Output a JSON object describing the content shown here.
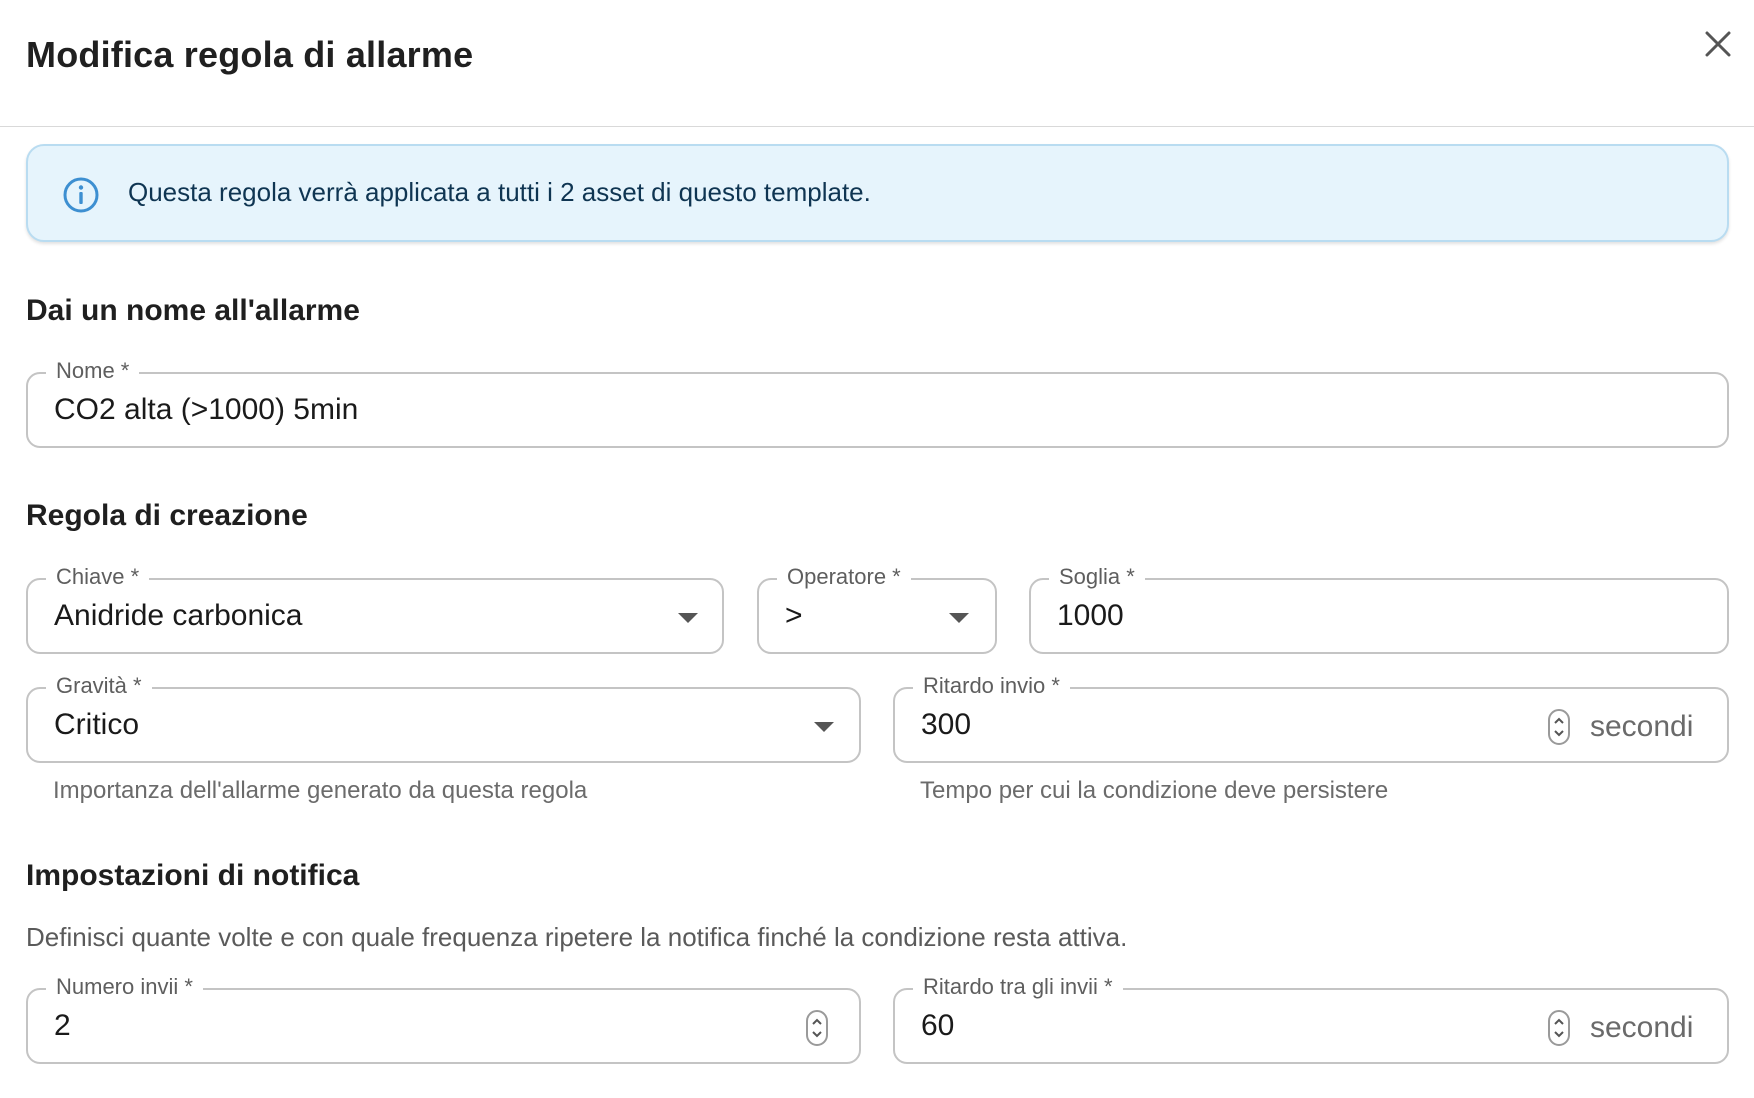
{
  "dialog": {
    "title": "Modifica regola di allarme",
    "close_icon": "close-icon"
  },
  "info": {
    "icon": "info-icon",
    "text": "Questa regola verrà applicata a tutti i 2 asset di questo template."
  },
  "sections": {
    "name": "Dai un nome all'allarme",
    "rule": "Regola di creazione",
    "notify": "Impostazioni di notifica"
  },
  "fields": {
    "nome": {
      "label": "Nome *",
      "value": "CO2 alta (>1000) 5min"
    },
    "chiave": {
      "label": "Chiave *",
      "value": "Anidride carbonica"
    },
    "operatore": {
      "label": "Operatore *",
      "value": ">"
    },
    "soglia": {
      "label": "Soglia *",
      "value": "1000"
    },
    "gravita": {
      "label": "Gravità *",
      "value": "Critico",
      "helper": "Importanza dell'allarme generato da questa regola"
    },
    "ritardo_invio": {
      "label": "Ritardo invio *",
      "value": "300",
      "suffix": "secondi",
      "helper": "Tempo per cui la condizione deve persistere"
    },
    "numero_invii": {
      "label": "Numero invii *",
      "value": "2"
    },
    "ritardo_tra_invii": {
      "label": "Ritardo tra gli invii *",
      "value": "60",
      "suffix": "secondi"
    }
  },
  "notify_description": "Definisci quante volte e con quale frequenza ripetere la notifica finché la condizione resta attiva.",
  "colors": {
    "info_bg": "#e6f4fc",
    "info_border": "#b9dcf1",
    "info_icon": "#3d8fd1",
    "field_border": "#c4c4c4"
  }
}
